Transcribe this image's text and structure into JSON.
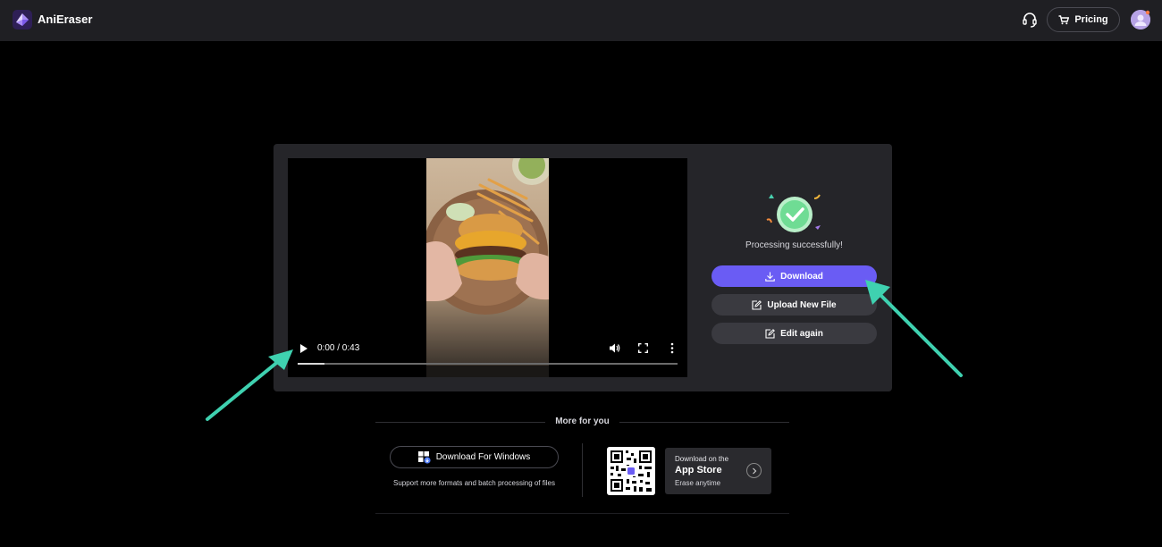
{
  "header": {
    "brand": "AniEraser",
    "pricing_label": "Pricing",
    "support_icon": "headset-icon",
    "cart_icon": "cart-icon"
  },
  "player": {
    "time": "0:00 / 0:43",
    "progress": 0.07
  },
  "result": {
    "status": "Processing successfully!",
    "download_label": "Download",
    "upload_label": "Upload New File",
    "edit_label": "Edit again"
  },
  "more": {
    "title": "More for you",
    "windows_label": "Download For Windows",
    "windows_desc": "Support more formats and batch processing of files",
    "appstore_small": "Download on the",
    "appstore_big": "App Store",
    "appstore_sub": "Erase anytime"
  },
  "colors": {
    "accent": "#6a5cf4",
    "arrow": "#3fd1b0",
    "success": "#6fdc94"
  }
}
